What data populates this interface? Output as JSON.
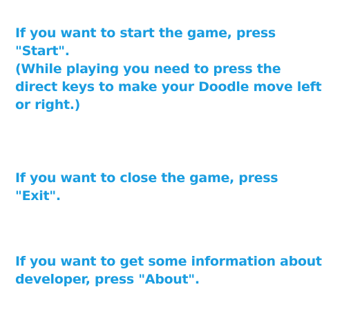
{
  "help": {
    "start": {
      "lines": [
        "If you want to start the game, press",
        "\"Start\".",
        "(While playing you need to press the",
        "direct keys to make your Doodle move left",
        "or right.)"
      ]
    },
    "exit": {
      "lines": [
        "If you want to close the game, press",
        "\"Exit\"."
      ]
    },
    "about": {
      "lines": [
        "If you want to get some information about",
        "developer, press \"About\"."
      ]
    }
  },
  "colors": {
    "background": "#ffffff",
    "text": "#1a9de0"
  }
}
